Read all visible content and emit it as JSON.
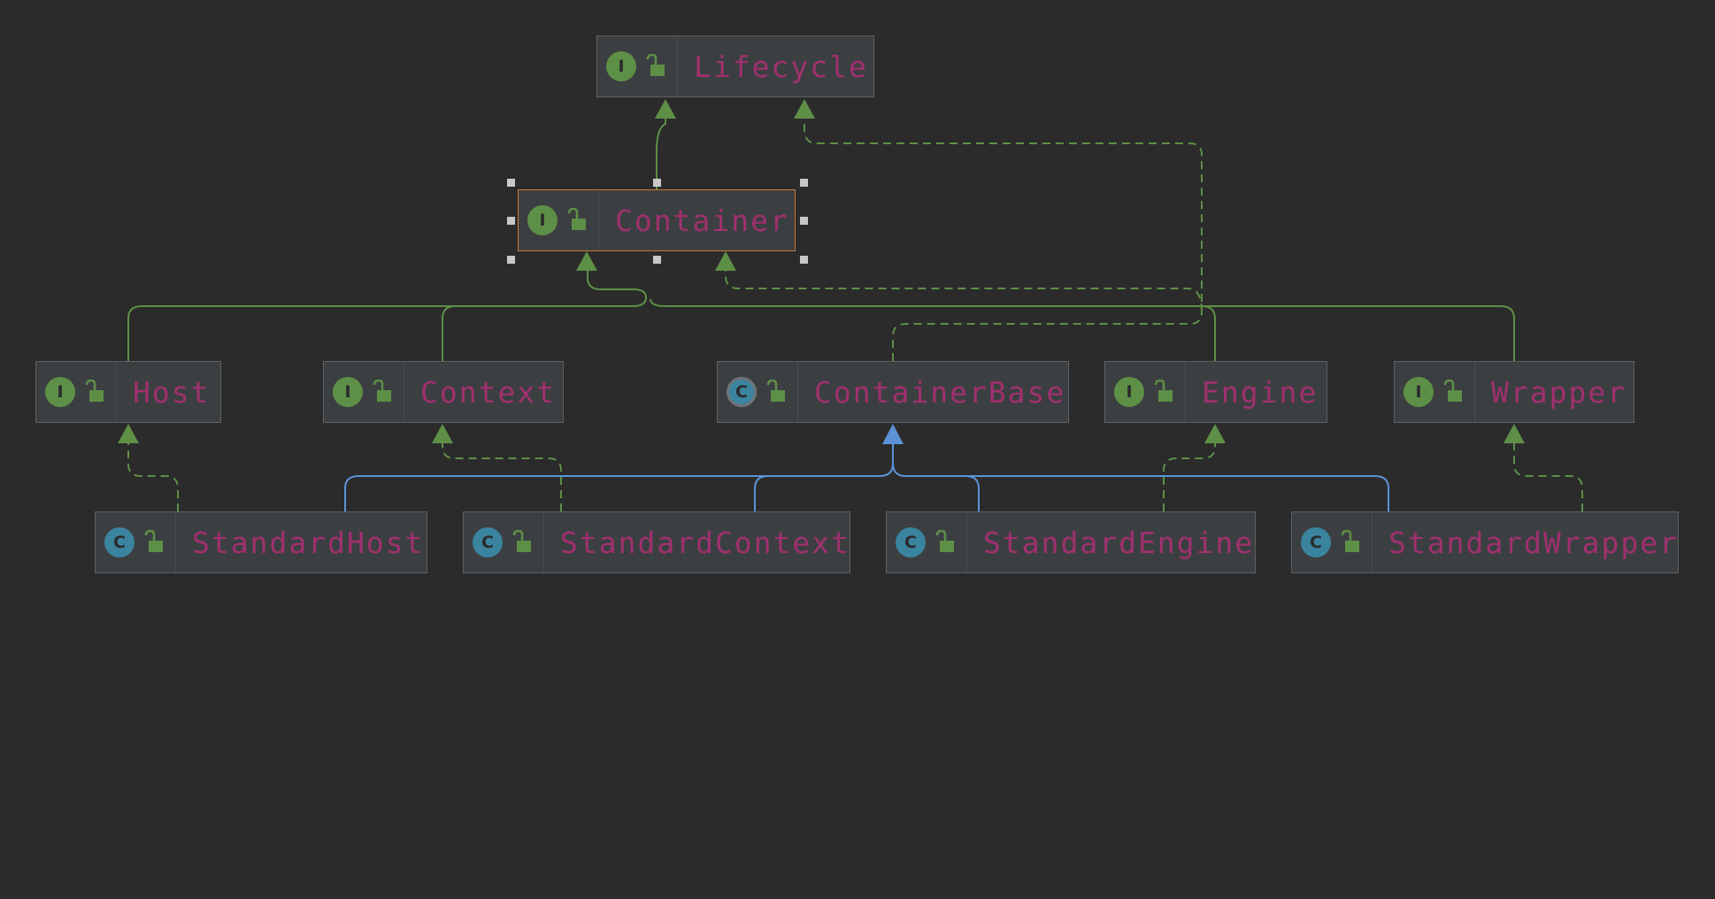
{
  "diagram": {
    "nodes": [
      {
        "id": "lifecycle",
        "kind": "interface",
        "badge": "I",
        "label": "Lifecycle"
      },
      {
        "id": "container",
        "kind": "interface",
        "badge": "I",
        "label": "Container",
        "selected": true
      },
      {
        "id": "host",
        "kind": "interface",
        "badge": "I",
        "label": "Host"
      },
      {
        "id": "context",
        "kind": "interface",
        "badge": "I",
        "label": "Context"
      },
      {
        "id": "containerbase",
        "kind": "abstract-class",
        "badge": "C",
        "label": "ContainerBase"
      },
      {
        "id": "engine",
        "kind": "interface",
        "badge": "I",
        "label": "Engine"
      },
      {
        "id": "wrapper",
        "kind": "interface",
        "badge": "I",
        "label": "Wrapper"
      },
      {
        "id": "standardhost",
        "kind": "class",
        "badge": "C",
        "label": "StandardHost"
      },
      {
        "id": "standardcontext",
        "kind": "class",
        "badge": "C",
        "label": "StandardContext"
      },
      {
        "id": "standardengine",
        "kind": "class",
        "badge": "C",
        "label": "StandardEngine"
      },
      {
        "id": "standardwrapper",
        "kind": "class",
        "badge": "C",
        "label": "StandardWrapper"
      }
    ],
    "edges": [
      {
        "from": "container",
        "to": "lifecycle",
        "type": "extends"
      },
      {
        "from": "containerbase",
        "to": "lifecycle",
        "type": "implements"
      },
      {
        "from": "host",
        "to": "container",
        "type": "extends"
      },
      {
        "from": "context",
        "to": "container",
        "type": "extends"
      },
      {
        "from": "engine",
        "to": "container",
        "type": "extends"
      },
      {
        "from": "wrapper",
        "to": "container",
        "type": "extends"
      },
      {
        "from": "containerbase",
        "to": "container",
        "type": "implements"
      },
      {
        "from": "standardhost",
        "to": "host",
        "type": "implements"
      },
      {
        "from": "standardcontext",
        "to": "context",
        "type": "implements"
      },
      {
        "from": "standardengine",
        "to": "engine",
        "type": "implements"
      },
      {
        "from": "standardwrapper",
        "to": "wrapper",
        "type": "implements"
      },
      {
        "from": "standardhost",
        "to": "containerbase",
        "type": "class-extends"
      },
      {
        "from": "standardcontext",
        "to": "containerbase",
        "type": "class-extends"
      },
      {
        "from": "standardengine",
        "to": "containerbase",
        "type": "class-extends"
      },
      {
        "from": "standardwrapper",
        "to": "containerbase",
        "type": "class-extends"
      }
    ]
  },
  "colors": {
    "background": "#2b2b2b",
    "interface_edge": "#5e8f47",
    "class_edge": "#5b93d6",
    "label": "#a0306f",
    "selection": "#c77a3a"
  },
  "icons": {
    "interface": "interface-icon",
    "class": "class-icon",
    "abstract": "abstract-class-icon",
    "visibility": "public-lock-icon"
  }
}
